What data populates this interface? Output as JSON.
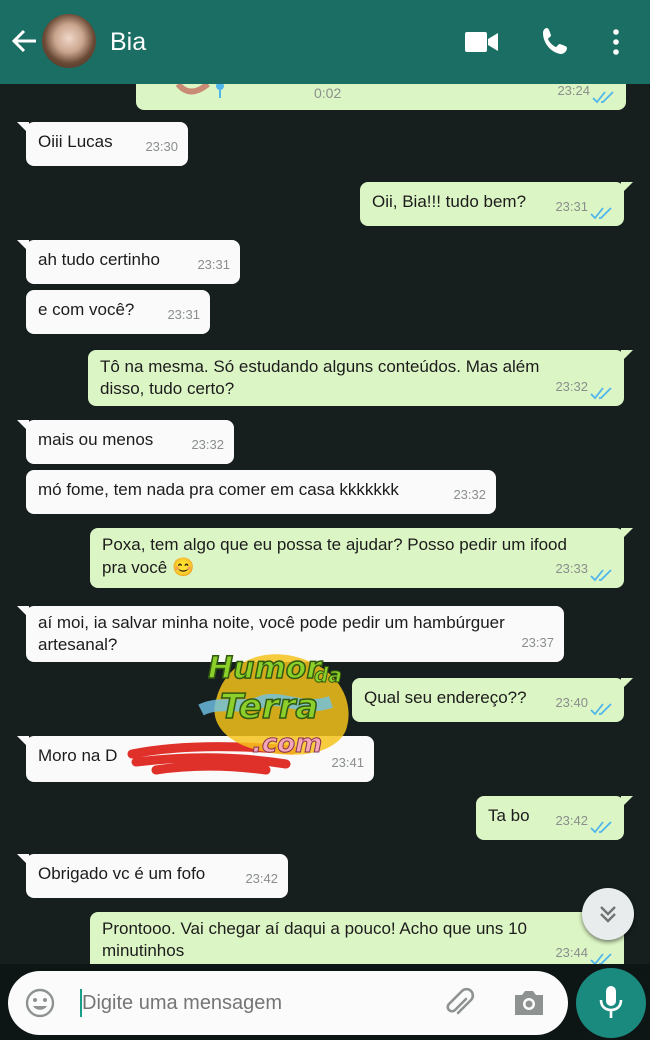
{
  "header": {
    "contact_name": "Bia",
    "accent_color": "#1a6e63",
    "icons": [
      "back-arrow-icon",
      "video-call-icon",
      "phone-icon",
      "more-options-icon"
    ]
  },
  "audio_message": {
    "duration": "0:02",
    "time": "23:24",
    "status": "read"
  },
  "messages": [
    {
      "dir": "in",
      "text": "Oiii Lucas",
      "time": "23:30"
    },
    {
      "dir": "out",
      "text": "Oii, Bia!!! tudo bem?",
      "time": "23:31",
      "status": "read"
    },
    {
      "dir": "in",
      "text": "ah tudo certinho",
      "time": "23:31"
    },
    {
      "dir": "in",
      "text": "e com você?",
      "time": "23:31"
    },
    {
      "dir": "out",
      "line1": "Tô na mesma. Só estudando alguns conteúdos. Mas além",
      "line2": "disso, tudo certo?",
      "time": "23:32",
      "status": "read"
    },
    {
      "dir": "in",
      "text": "mais ou menos",
      "time": "23:32"
    },
    {
      "dir": "in",
      "text": "mó fome, tem nada pra comer em casa kkkkkkk",
      "time": "23:32"
    },
    {
      "dir": "out",
      "line1": "Poxa, tem algo que eu possa te ajudar? Posso pedir um ifood",
      "line2": "pra você",
      "emoji": "😊",
      "time": "23:33",
      "status": "read"
    },
    {
      "dir": "in",
      "line1": "aí moi, ia salvar minha noite, você pode pedir um hambúrguer",
      "line2": "artesanal?",
      "time": "23:37"
    },
    {
      "dir": "out",
      "text": "Qual seu endereço??",
      "time": "23:40",
      "status": "read"
    },
    {
      "dir": "in",
      "text": "Moro na D",
      "time": "23:41"
    },
    {
      "dir": "out",
      "text": "Ta bo",
      "time": "23:42",
      "status": "read"
    },
    {
      "dir": "in",
      "text": "Obrigado vc é um fofo",
      "time": "23:42"
    },
    {
      "dir": "out",
      "line1": "Prontooo. Vai chegar aí daqui a pouco! Acho que uns 10",
      "line2": "minutinhos",
      "time": "23:44",
      "status": "read"
    }
  ],
  "watermark": {
    "line1": "Humor",
    "line2": "da",
    "line3": "Terra",
    "line4": ".com"
  },
  "composer": {
    "placeholder": "Digite uma mensagem",
    "icons": [
      "emoji-icon",
      "attach-icon",
      "camera-icon",
      "mic-icon"
    ]
  },
  "colors": {
    "incoming": "#fafafa",
    "outgoing": "#dcf5c5",
    "read_ticks": "#4fb6ec",
    "background": "#161e1e"
  }
}
